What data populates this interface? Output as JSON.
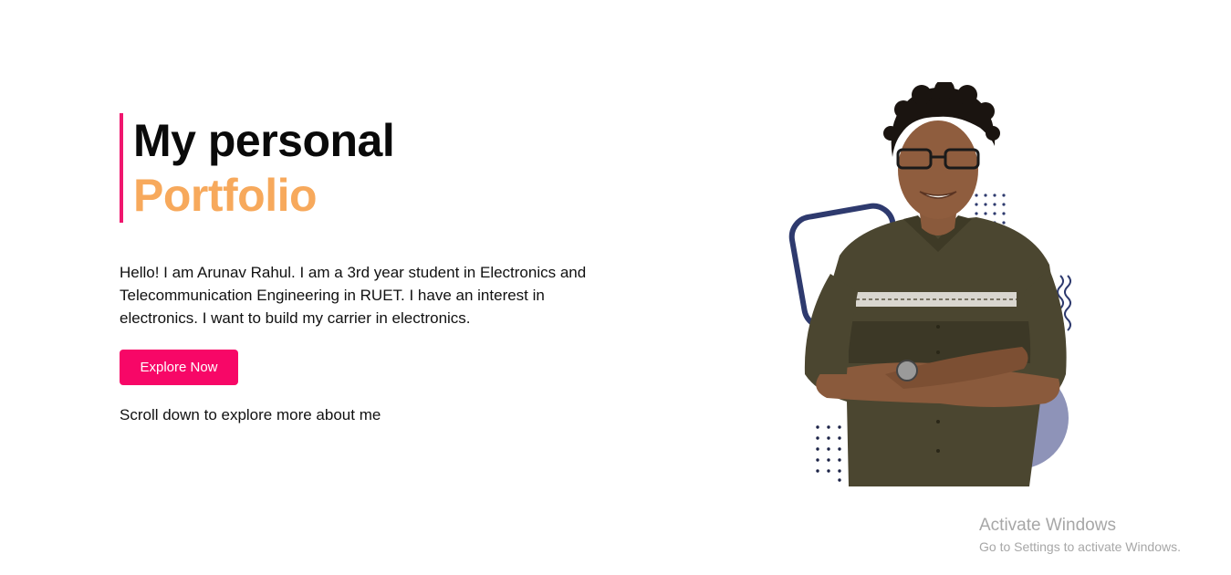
{
  "hero": {
    "title_line_1": "My personal",
    "title_line_2": "Portfolio",
    "intro": "Hello! I am Arunav Rahul. I am a 3rd year student in Electronics and Telecommunication Engineering in RUET. I have an interest in electronics. I want to build my carrier in electronics.",
    "cta_label": "Explore Now",
    "scroll_hint": "Scroll down to explore more about me"
  },
  "illustration": {
    "subject": "portrait-photo"
  },
  "watermark": {
    "title": "Activate Windows",
    "subtitle": "Go to Settings to activate Windows."
  },
  "colors": {
    "accent_bar": "#f0166e",
    "title_primary": "#0a0a0a",
    "title_highlight": "#f7a95c",
    "button_bg": "#f70767",
    "decor_navy": "#2e3a6e",
    "decor_lavender": "#8e93b8"
  }
}
